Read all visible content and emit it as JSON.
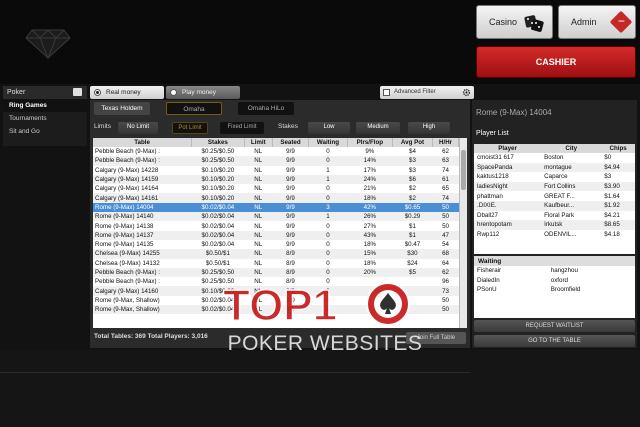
{
  "header": {
    "casino_label": "Casino",
    "admin_label": "Admin",
    "cashier_label": "CASHIER"
  },
  "nav": {
    "section": "Poker",
    "items": [
      "Ring Games",
      "Tournaments",
      "Sit and Go"
    ]
  },
  "modes": {
    "real": "Real money",
    "play": "Play money",
    "advanced_filter": "Advanced Filter"
  },
  "game_tabs": [
    "Texas Holdem",
    "Omaha",
    "Omaha HiLo"
  ],
  "filters": {
    "limits_label": "Limits",
    "no_limit": "No Limit",
    "pot_limit": "Pot Limit",
    "fixed_limit": "Fixed Limit",
    "stakes_label": "Stakes",
    "low": "Low",
    "medium": "Medium",
    "high": "High"
  },
  "lobby": {
    "columns": [
      "Table",
      "Stakes",
      "Limit",
      "Seated",
      "Waiting",
      "Plrs/Flop",
      "Avg Pot",
      "H/Hr"
    ],
    "rows": [
      [
        "Pebble Beach (9-Max) :",
        "$0.25/$0.50",
        "NL",
        "9/9",
        "0",
        "9%",
        "$4",
        "62"
      ],
      [
        "Pebble Beach (9-Max) :",
        "$0.25/$0.50",
        "NL",
        "9/9",
        "0",
        "14%",
        "$3",
        "63"
      ],
      [
        "Calgary (9-Max) 14228",
        "$0.10/$0.20",
        "NL",
        "9/9",
        "1",
        "17%",
        "$3",
        "74"
      ],
      [
        "Calgary (9-Max) 14159",
        "$0.10/$0.20",
        "NL",
        "9/9",
        "1",
        "24%",
        "$6",
        "61"
      ],
      [
        "Calgary (9-Max) 14164",
        "$0.10/$0.20",
        "NL",
        "9/9",
        "0",
        "21%",
        "$2",
        "65"
      ],
      [
        "Calgary (9-Max) 14161",
        "$0.10/$0.20",
        "NL",
        "9/9",
        "0",
        "18%",
        "$2",
        "74"
      ],
      [
        "Rome (9-Max) 14004",
        "$0.02/$0.04",
        "NL",
        "9/9",
        "3",
        "42%",
        "$0.65",
        "50"
      ],
      [
        "Rome (9-Max) 14140",
        "$0.02/$0.04",
        "NL",
        "9/9",
        "1",
        "26%",
        "$0.29",
        "50"
      ],
      [
        "Rome (9-Max) 14138",
        "$0.02/$0.04",
        "NL",
        "9/9",
        "0",
        "27%",
        "$1",
        "50"
      ],
      [
        "Rome (9-Max) 14137",
        "$0.02/$0.04",
        "NL",
        "9/9",
        "0",
        "43%",
        "$1",
        "47"
      ],
      [
        "Rome (9-Max) 14135",
        "$0.02/$0.04",
        "NL",
        "9/9",
        "0",
        "18%",
        "$0.47",
        "54"
      ],
      [
        "Chelsea (9-Max) 14255",
        "$0.50/$1",
        "NL",
        "8/9",
        "0",
        "15%",
        "$30",
        "68"
      ],
      [
        "Chelsea (9-Max) 14132",
        "$0.50/$1",
        "NL",
        "8/9",
        "0",
        "18%",
        "$24",
        "64"
      ],
      [
        "Pebble Beach (9-Max) :",
        "$0.25/$0.50",
        "NL",
        "8/9",
        "0",
        "20%",
        "$5",
        "62"
      ],
      [
        "Pebble Beach (9-Max) :",
        "$0.25/$0.50",
        "NL",
        "8/9",
        "0",
        "",
        "",
        "96"
      ],
      [
        "Calgary (9-Max) 14160",
        "$0.10/$0.20",
        "NL",
        "8/9",
        "0",
        "",
        "",
        "73"
      ],
      [
        "Rome (9-Max, Shallow)",
        "$0.02/$0.04",
        "NL",
        "8/9",
        "0",
        "",
        "",
        "50"
      ],
      [
        "Rome (9-Max, Shallow)",
        "$0.02/$0.04",
        "NL",
        "8/9",
        "0",
        "",
        "",
        "50"
      ]
    ],
    "selected_index": 6,
    "footer": "Total Tables: 369    Total Players: 3,016",
    "join_label": "Join Full Table"
  },
  "right_panel": {
    "title": "Rome (9-Max) 14004",
    "player_list_label": "Player List",
    "columns": [
      "Player",
      "City",
      "Chips"
    ],
    "players": [
      [
        "cmoist31 617",
        "Boston",
        "$0"
      ],
      [
        "SpacePanda",
        "montague",
        "$4.94"
      ],
      [
        "kaktus1218",
        "Caparce",
        "$3"
      ],
      [
        "ladiesNight",
        "Fort Collins",
        "$3.90"
      ],
      [
        "phattman",
        "GREAT F...",
        "$1.64"
      ],
      [
        ".DIXIE.",
        "Kaufbeur...",
        "$1.92"
      ],
      [
        "Dball27",
        "Floral Park",
        "$4.21"
      ],
      [
        "hrentopotam",
        "Irkutsk",
        "$8.65"
      ],
      [
        "Rwp112",
        "ODENVIL...",
        "$4.18"
      ]
    ],
    "waiting_label": "Waiting",
    "waiting": [
      [
        "Fisherair",
        "hangzhou"
      ],
      [
        "DialedIn",
        "oxford"
      ],
      [
        "PSonU",
        "Broomfield"
      ]
    ],
    "request_label": "REQUEST WAITLIST",
    "goto_label": "GO TO THE TABLE"
  },
  "watermark": {
    "logo_text": "TOP10",
    "subtitle": "POKER WEBSITES"
  }
}
